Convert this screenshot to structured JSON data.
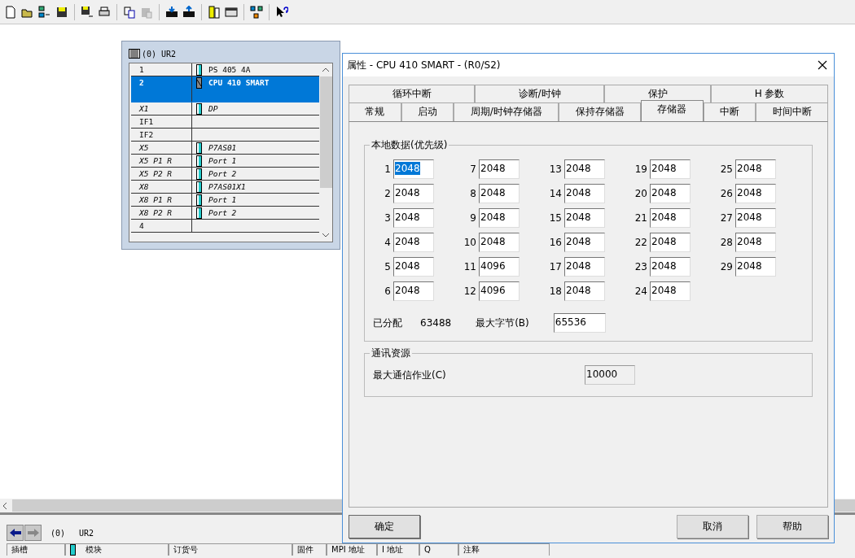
{
  "rack": {
    "title": "(0)  UR2",
    "rows": [
      {
        "slot": "1",
        "module": "PS 405 4A",
        "kind": "module",
        "selected": false
      },
      {
        "slot": "2",
        "module": "CPU 410 SMART",
        "kind": "cpu",
        "selected": true
      },
      {
        "slot": "X1",
        "module": "DP",
        "kind": "interface",
        "selected": false
      },
      {
        "slot": "IF1",
        "module": "",
        "kind": "empty",
        "selected": false
      },
      {
        "slot": "IF2",
        "module": "",
        "kind": "empty",
        "selected": false
      },
      {
        "slot": "X5",
        "module": "P7AS01",
        "kind": "interface",
        "selected": false
      },
      {
        "slot": "X5 P1 R",
        "module": "Port 1",
        "kind": "interface",
        "selected": false
      },
      {
        "slot": "X5 P2 R",
        "module": "Port 2",
        "kind": "interface",
        "selected": false
      },
      {
        "slot": "X8",
        "module": "P7AS01X1",
        "kind": "interface",
        "selected": false
      },
      {
        "slot": "X8 P1 R",
        "module": "Port 1",
        "kind": "interface",
        "selected": false
      },
      {
        "slot": "X8 P2 R",
        "module": "Port 2",
        "kind": "interface",
        "selected": false
      },
      {
        "slot": "4",
        "module": "",
        "kind": "empty",
        "selected": false
      }
    ]
  },
  "dialog": {
    "title": "属性 - CPU 410 SMART - (R0/S2)",
    "tabs_row_1": [
      {
        "label": "循环中断",
        "selected": false
      },
      {
        "label": "诊断/时钟",
        "selected": false
      },
      {
        "label": "保护",
        "selected": false
      },
      {
        "label": "H 参数",
        "selected": false
      }
    ],
    "tabs_row_2": [
      {
        "label": "常规",
        "selected": false
      },
      {
        "label": "启动",
        "selected": false
      },
      {
        "label": "周期/时钟存储器",
        "selected": false
      },
      {
        "label": "保持存储器",
        "selected": false
      },
      {
        "label": "存储器",
        "selected": true
      },
      {
        "label": "中断",
        "selected": false
      },
      {
        "label": "时间中断",
        "selected": false
      }
    ],
    "local_data": {
      "title": "本地数据(优先级)",
      "fields": [
        {
          "label": "1",
          "value": "2048",
          "selected": true
        },
        {
          "label": "2",
          "value": "2048",
          "selected": false
        },
        {
          "label": "3",
          "value": "2048",
          "selected": false
        },
        {
          "label": "4",
          "value": "2048",
          "selected": false
        },
        {
          "label": "5",
          "value": "2048",
          "selected": false
        },
        {
          "label": "6",
          "value": "2048",
          "selected": false
        },
        {
          "label": "7",
          "value": "2048",
          "selected": false
        },
        {
          "label": "8",
          "value": "2048",
          "selected": false
        },
        {
          "label": "9",
          "value": "2048",
          "selected": false
        },
        {
          "label": "10",
          "value": "2048",
          "selected": false
        },
        {
          "label": "11",
          "value": "4096",
          "selected": false
        },
        {
          "label": "12",
          "value": "4096",
          "selected": false
        },
        {
          "label": "13",
          "value": "2048",
          "selected": false
        },
        {
          "label": "14",
          "value": "2048",
          "selected": false
        },
        {
          "label": "15",
          "value": "2048",
          "selected": false
        },
        {
          "label": "16",
          "value": "2048",
          "selected": false
        },
        {
          "label": "17",
          "value": "2048",
          "selected": false
        },
        {
          "label": "18",
          "value": "2048",
          "selected": false
        },
        {
          "label": "19",
          "value": "2048",
          "selected": false
        },
        {
          "label": "20",
          "value": "2048",
          "selected": false
        },
        {
          "label": "21",
          "value": "2048",
          "selected": false
        },
        {
          "label": "22",
          "value": "2048",
          "selected": false
        },
        {
          "label": "23",
          "value": "2048",
          "selected": false
        },
        {
          "label": "24",
          "value": "2048",
          "selected": false
        },
        {
          "label": "25",
          "value": "2048",
          "selected": false
        },
        {
          "label": "26",
          "value": "2048",
          "selected": false
        },
        {
          "label": "27",
          "value": "2048",
          "selected": false
        },
        {
          "label": "28",
          "value": "2048",
          "selected": false
        },
        {
          "label": "29",
          "value": "2048",
          "selected": false
        }
      ],
      "allocated_label": "已分配",
      "allocated_value": "63488",
      "max_bytes_label": "最大字节(B)",
      "max_bytes_value": "65536"
    },
    "communication": {
      "title": "通讯资源",
      "max_jobs_label": "最大通信作业(C)",
      "max_jobs_value": "10000",
      "disabled": true
    },
    "buttons": {
      "ok": "确定",
      "cancel": "取消",
      "help": "帮助"
    }
  },
  "bottom_panel": {
    "rack_number": "(0)",
    "rack_name": "UR2",
    "columns": [
      "插槽",
      "模块",
      "订货号",
      "固件",
      "MPI 地址",
      "I 地址",
      "Q",
      "注释"
    ]
  }
}
